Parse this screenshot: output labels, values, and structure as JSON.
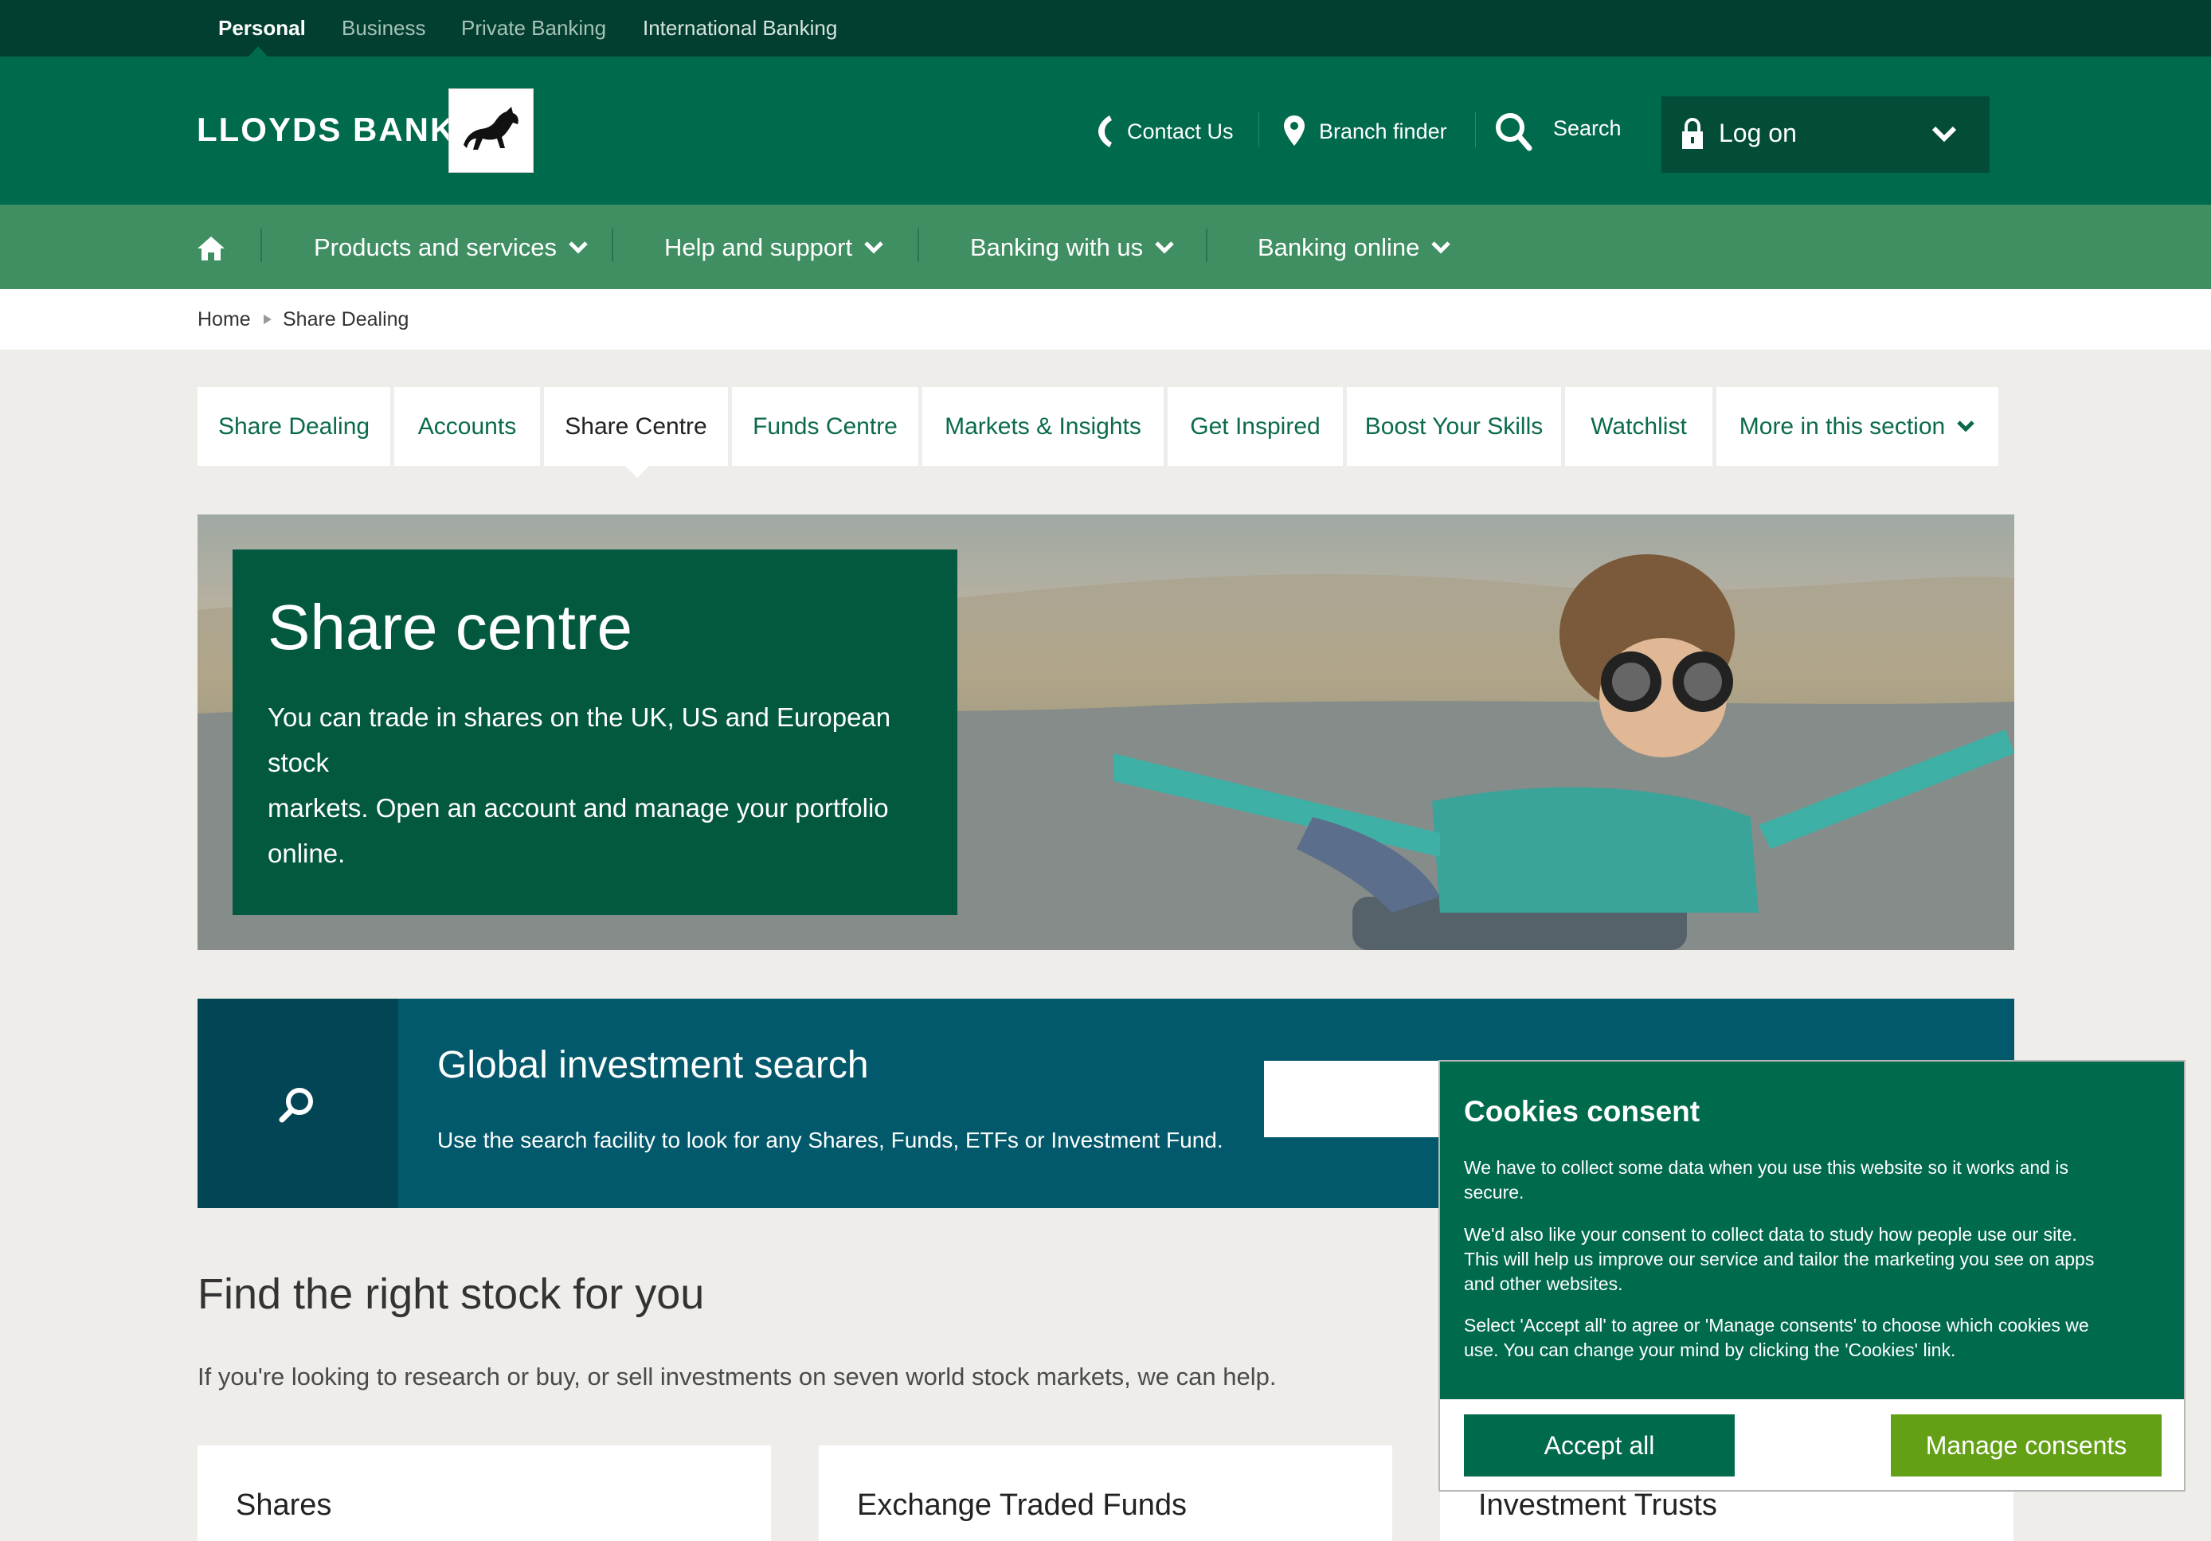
{
  "segments": [
    "Personal",
    "Business",
    "Private Banking",
    "International Banking"
  ],
  "brand": {
    "name": "LLOYDS BANK",
    "logo_icon": "black-horse-icon",
    "primary_color": "#006a4d",
    "dark_color": "#023f30"
  },
  "utility": {
    "contact": "Contact Us",
    "branch": "Branch finder",
    "search": "Search",
    "logon": "Log on"
  },
  "nav": {
    "home_icon": "home-icon",
    "items": [
      "Products and services",
      "Help and support",
      "Banking with us",
      "Banking online"
    ]
  },
  "breadcrumb": [
    "Home",
    "Share Dealing"
  ],
  "tabs": [
    "Share Dealing",
    "Accounts",
    "Share Centre",
    "Funds Centre",
    "Markets & Insights",
    "Get Inspired",
    "Boost Your Skills",
    "Watchlist",
    "More in this section"
  ],
  "active_tab": "Share Centre",
  "hero": {
    "title": "Share centre",
    "lines": [
      "You can trade in shares on the UK, US and European stock",
      "markets. Open an account and manage your portfolio",
      "online."
    ]
  },
  "global_search": {
    "title": "Global investment search",
    "desc": "Use the search facility to look for any Shares, Funds, ETFs or Investment Fund.",
    "input_value": ""
  },
  "main": {
    "heading": "Find the right stock for you",
    "lede": "If you're looking to research or buy, or sell investments on seven world stock markets, we can help.",
    "cards": [
      "Shares",
      "Exchange Traded Funds",
      "Investment Trusts"
    ]
  },
  "cookie": {
    "title": "Cookies consent",
    "para1": [
      "We have to collect some data when you use this website so it works and is",
      "secure."
    ],
    "para2": [
      "We'd also like your consent to collect data to study how people use our site.",
      "This will help us improve our service and tailor the marketing you see on apps",
      "and other websites."
    ],
    "para3": [
      "Select 'Accept all' to agree or 'Manage consents' to choose which cookies we",
      "use. You can change your mind by clicking the 'Cookies' link."
    ],
    "accept": "Accept all",
    "manage": "Manage consents"
  }
}
